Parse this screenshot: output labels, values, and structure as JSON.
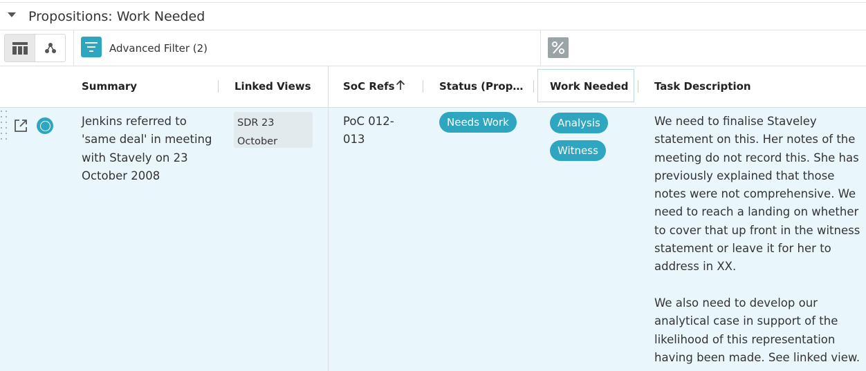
{
  "section": {
    "title": "Propositions: Work Needed"
  },
  "toolbar": {
    "view_modes": [
      "grid-view-icon",
      "graph-view-icon"
    ],
    "filter_label": "Advanced Filter (2)",
    "percent_icon": "percent-icon"
  },
  "columns": {
    "summary": "Summary",
    "linked_views": "Linked Views",
    "soc_refs": "SoC Refs",
    "status": "Status (Prop…",
    "work_needed": "Work Needed",
    "task_description": "Task Description"
  },
  "sort": {
    "column": "SoC Refs",
    "direction": "ascending"
  },
  "rows": [
    {
      "summary": "Jenkins referred to 'same deal' in meeting with Stavely on 23 October 2008",
      "linked_view": "SDR 23 October",
      "soc_ref": "PoC 012-013",
      "status": "Needs Work",
      "work_needed": [
        "Analysis",
        "Witness"
      ],
      "task_description": [
        "We need to finalise Staveley statement on this.  Her notes of the meeting do not record this.  She has previously explained that those notes were not comprehensive.  We need to reach a landing on whether to cover that up front in the witness statement or leave it for her to address in XX.",
        "We also need to develop our analytical case in support of the likelihood of this representation having been made. See linked view."
      ]
    }
  ],
  "colors": {
    "accent": "#2ea6c0",
    "row_highlight": "#e9f7fd",
    "chip_bg": "#e3eaee"
  }
}
